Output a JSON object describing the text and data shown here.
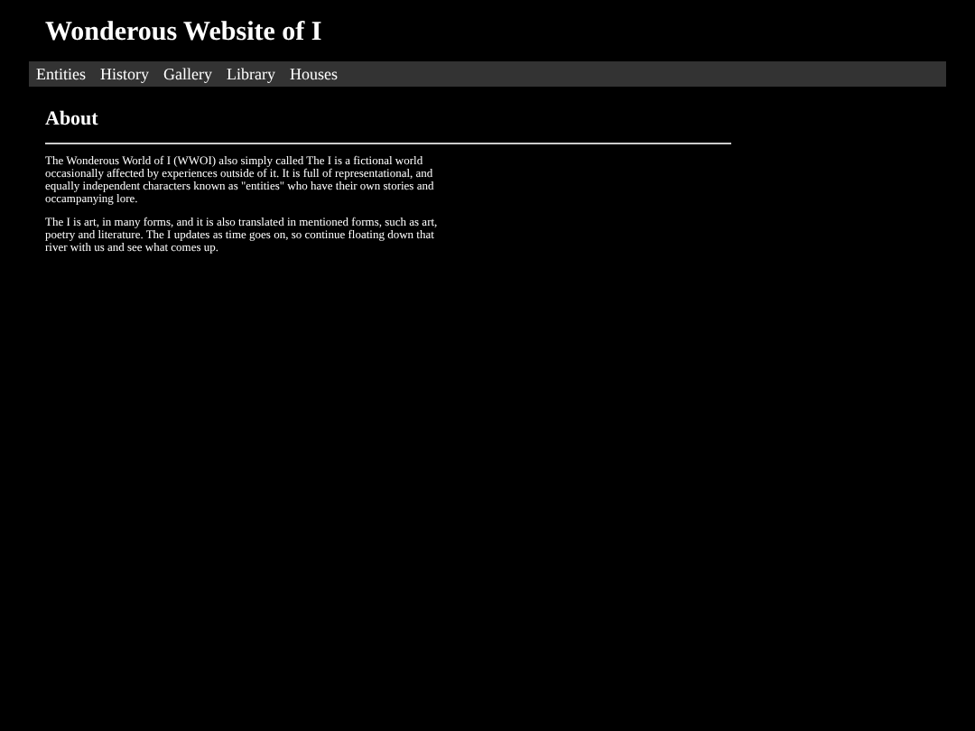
{
  "site_title": "Wonderous Website of I",
  "nav": [
    {
      "label": "Entities"
    },
    {
      "label": "History"
    },
    {
      "label": "Gallery"
    },
    {
      "label": "Library"
    },
    {
      "label": "Houses"
    }
  ],
  "section": {
    "heading": "About",
    "paragraphs": [
      "The Wonderous World of I (WWOI) also simply called The I is a fictional world occasionally affected by experiences outside of it. It is full of representational, and equally independent characters known as \"entities\" who have their own stories and occampanying lore.",
      "The I is art, in many forms, and it is also translated in mentioned forms, such as art, poetry and literature. The I updates as time goes on, so continue floating down that river with us and see what comes up."
    ]
  }
}
